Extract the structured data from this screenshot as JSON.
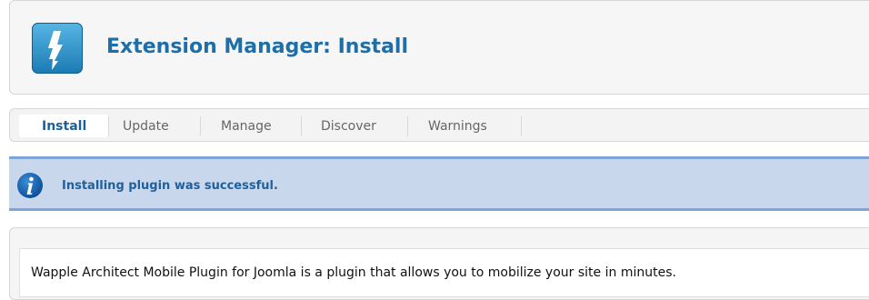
{
  "header": {
    "title": "Extension Manager: Install",
    "icon": "extension-lightning-icon"
  },
  "tabs": [
    {
      "label": "Install",
      "active": true
    },
    {
      "label": "Update",
      "active": false
    },
    {
      "label": "Manage",
      "active": false
    },
    {
      "label": "Discover",
      "active": false
    },
    {
      "label": "Warnings",
      "active": false
    }
  ],
  "message": {
    "icon": "info-icon",
    "text": "Installing plugin was successful."
  },
  "content": {
    "description": "Wapple Architect Mobile Plugin for Joomla is a plugin that allows you to mobilize your site in minutes."
  },
  "colors": {
    "title": "#1e6fa8",
    "message_bg": "#c8d7eb",
    "message_border": "#7ca6d8",
    "message_text": "#1f5f9c"
  }
}
